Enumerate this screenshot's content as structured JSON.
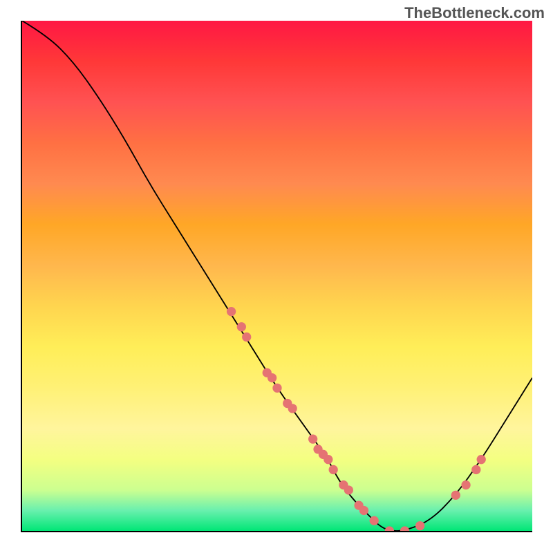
{
  "watermark": "TheBottleneck.com",
  "chart_data": {
    "type": "line",
    "title": "",
    "xlabel": "",
    "ylabel": "",
    "xlim": [
      0,
      100
    ],
    "ylim": [
      0,
      100
    ],
    "x": [
      0,
      5,
      10,
      15,
      20,
      25,
      30,
      35,
      40,
      45,
      50,
      55,
      60,
      62,
      65,
      68,
      70,
      72,
      75,
      80,
      85,
      90,
      95,
      100
    ],
    "y": [
      100,
      97,
      92,
      85,
      77,
      68,
      60,
      52,
      44,
      36,
      28,
      21,
      14,
      10,
      6,
      3,
      1,
      0,
      0,
      2,
      7,
      14,
      22,
      30
    ],
    "marker_points": {
      "x": [
        41,
        43,
        44,
        48,
        49,
        50,
        52,
        53,
        57,
        58,
        59,
        60,
        61,
        63,
        64,
        66,
        67,
        69,
        72,
        75,
        78,
        85,
        87,
        89,
        90
      ],
      "y": [
        43,
        40,
        38,
        31,
        30,
        28,
        25,
        24,
        18,
        16,
        15,
        14,
        12,
        9,
        8,
        5,
        4,
        2,
        0,
        0,
        1,
        7,
        9,
        12,
        14
      ]
    },
    "marker_color": "#e57373",
    "curve_color": "#000000",
    "gradient_colors": {
      "top": "#ff1744",
      "middle": "#ffee58",
      "bottom": "#00e676"
    },
    "annotations": []
  }
}
